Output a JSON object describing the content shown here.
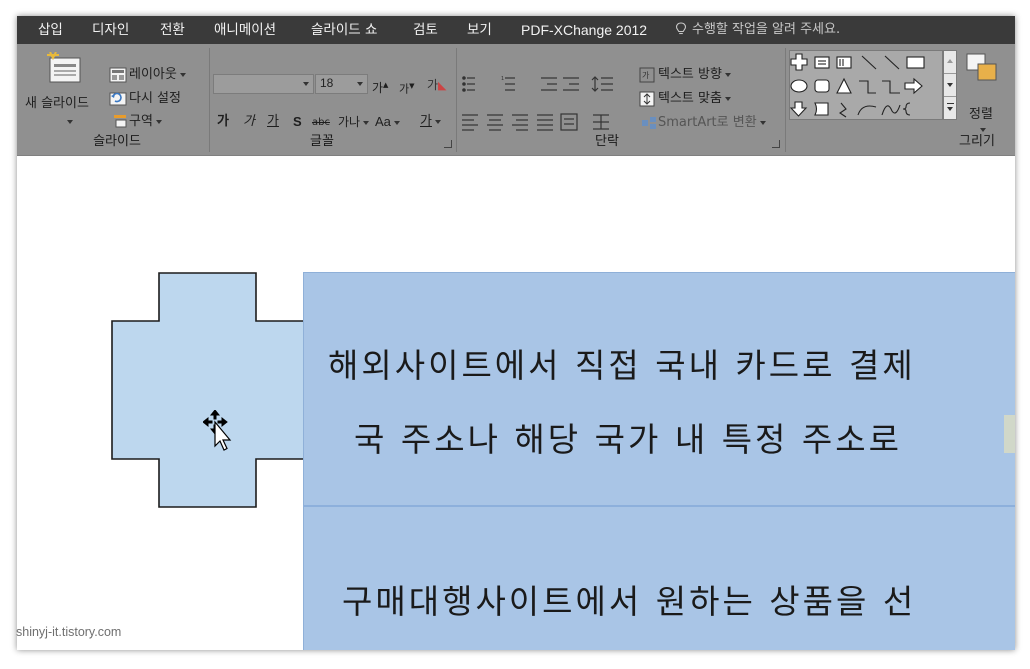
{
  "tabs": [
    "삽입",
    "디자인",
    "전환",
    "애니메이션",
    "슬라이드 쇼",
    "검토",
    "보기",
    "PDF-XChange 2012"
  ],
  "tell_me": "수행할 작업을 알려 주세요.",
  "ribbon": {
    "slides": {
      "new_slide": "새 슬라이드",
      "layout": "레이아웃",
      "reset": "다시 설정",
      "section": "구역",
      "label": "슬라이드"
    },
    "font": {
      "font_name": "",
      "font_size": "18",
      "grow": "가",
      "shrink": "가",
      "clear": "가",
      "bold": "가",
      "italic": "가",
      "underline": "가",
      "shadow": "S",
      "strike": "abc",
      "spacing": "가나",
      "case": "Aa",
      "color": "가",
      "label": "글꼴"
    },
    "paragraph": {
      "text_direction": "텍스트 방향",
      "align_text": "텍스트 맞춤",
      "smartart": "SmartArt로 변환",
      "label": "단락"
    },
    "drawing": {
      "arrange": "정렬",
      "label": "그리기"
    }
  },
  "slide": {
    "line1": "해외사이트에서 직접 국내 카드로 결제",
    "line2": "국 주소나 해당 국가 내 특정 주소로 ",
    "line3": "구매대행사이트에서 원하는 상품을 선"
  },
  "watermark": "shinyj-it.tistory.com",
  "colors": {
    "tabbar": "#3a3a3a",
    "ribbon": "#909090",
    "shape_fill": "#bdd7ee",
    "textbox_fill": "#a9c5e6"
  }
}
